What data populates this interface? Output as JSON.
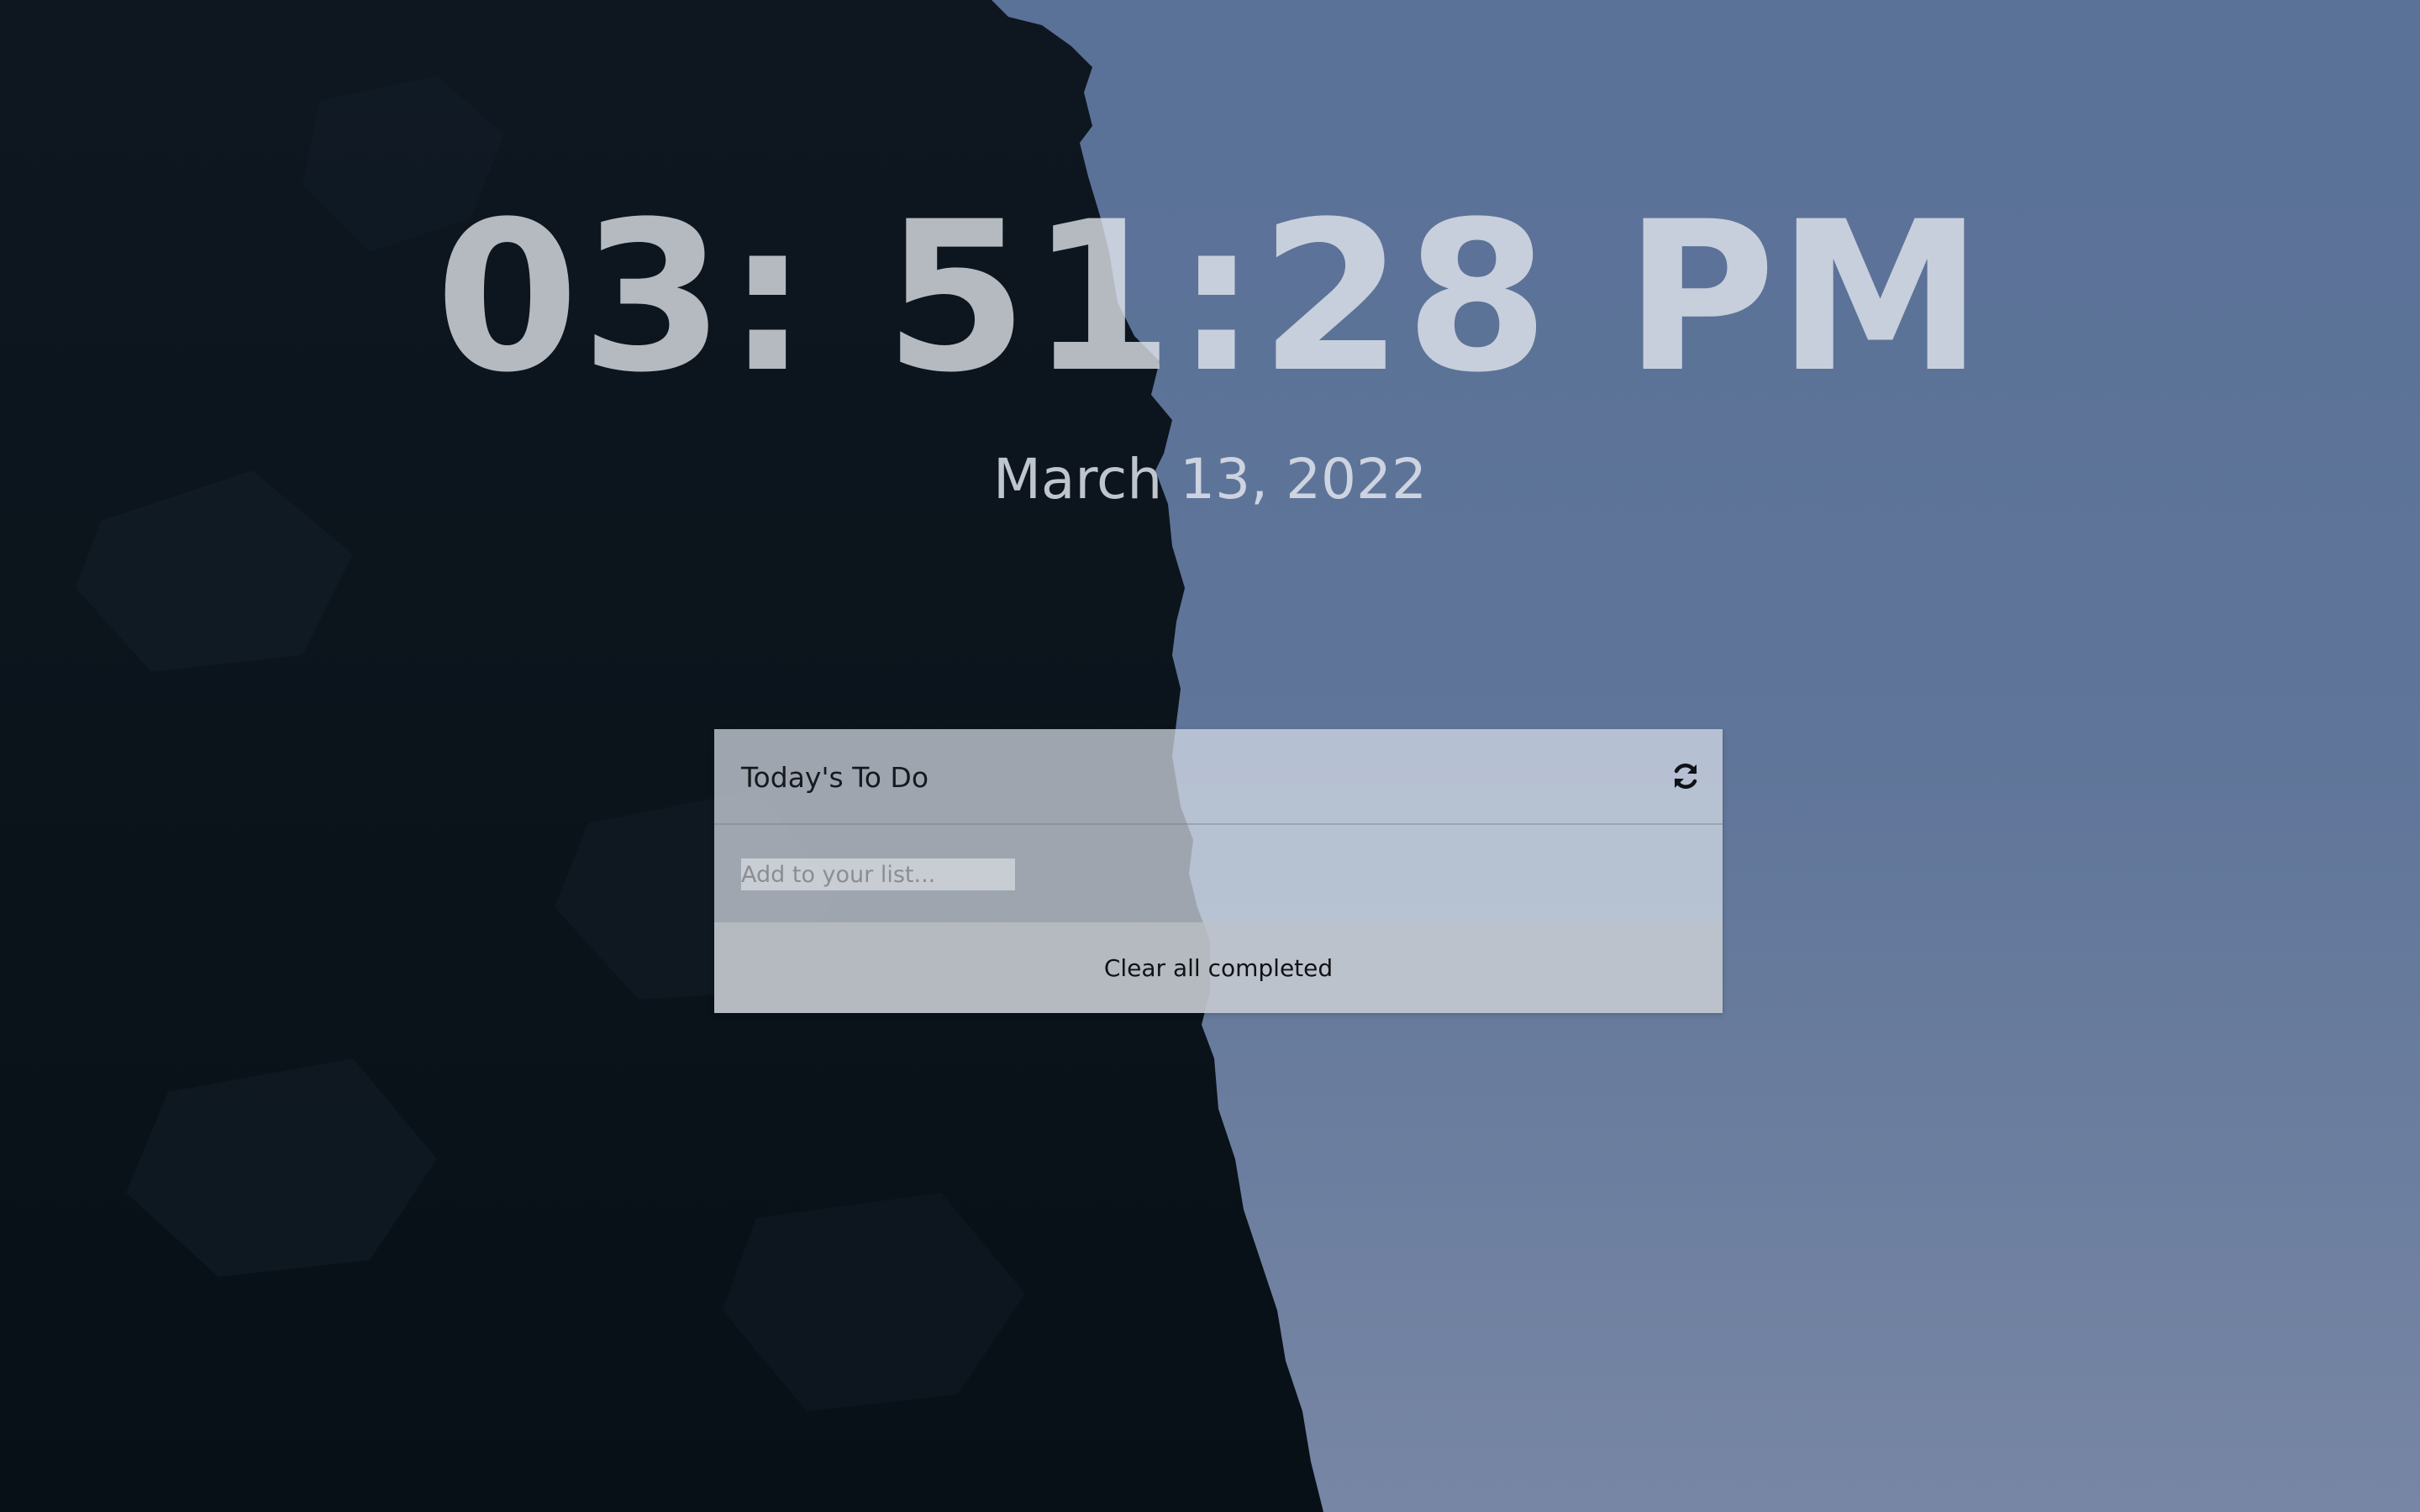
{
  "clock": {
    "time": "03: 51:28 PM"
  },
  "date": {
    "text": "March 13, 2022"
  },
  "todo": {
    "title": "Today's To Do",
    "refresh_icon": "refresh-icon",
    "input_placeholder": "Add to your list...",
    "input_value": "",
    "clear_label": "Clear all completed"
  },
  "colors": {
    "sky": "#5e7599",
    "cliff": "#0c141c",
    "panel": "#d7dee8",
    "footer": "#bec2c8"
  }
}
